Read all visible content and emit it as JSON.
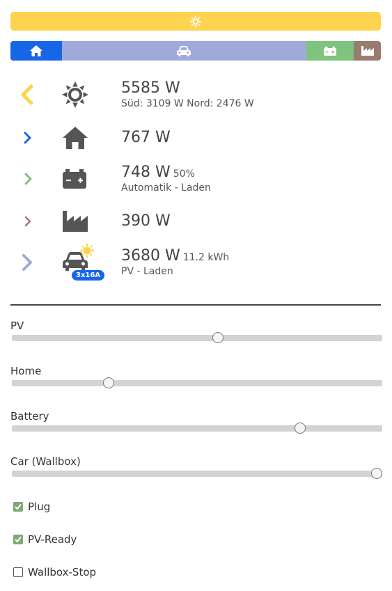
{
  "colors": {
    "pv": "#fdd34f",
    "home": "#1866e8",
    "car": "#a0a9db",
    "battery": "#7ec37e",
    "grid": "#9a7c6e",
    "icon": "#555555"
  },
  "distribution_bar": {
    "segments": [
      {
        "name": "home",
        "icon": "home-icon",
        "fraction": 0.139
      },
      {
        "name": "car",
        "icon": "car-icon",
        "fraction": 0.659
      },
      {
        "name": "battery",
        "icon": "battery-icon",
        "fraction": 0.129
      },
      {
        "name": "grid",
        "icon": "factory-icon",
        "fraction": 0.073
      }
    ]
  },
  "rows": {
    "pv": {
      "value": "5585 W",
      "sub": "Süd: 3109 W Nord: 2476 W",
      "icon": "sun-icon",
      "chevron": "chevron-left-icon"
    },
    "home": {
      "value": "767 W",
      "icon": "home-icon",
      "chevron": "chevron-right-icon"
    },
    "battery": {
      "value": "748 W",
      "extra": "50%",
      "sub": "Automatik - Laden",
      "icon": "battery-icon",
      "chevron": "chevron-right-icon"
    },
    "grid": {
      "value": "390 W",
      "icon": "factory-icon",
      "chevron": "chevron-right-icon"
    },
    "car": {
      "value": "3680 W",
      "extra": "11.2 kWh",
      "sub": "PV - Laden",
      "badge": "3x16A",
      "icon": "car-icon",
      "chevron": "chevron-right-icon"
    }
  },
  "sliders": [
    {
      "label": "PV",
      "fraction": 0.556
    },
    {
      "label": "Home",
      "fraction": 0.261
    },
    {
      "label": "Battery",
      "fraction": 0.779
    },
    {
      "label": "Car (Wallbox)",
      "fraction": 1.0
    }
  ],
  "checkboxes": [
    {
      "label": "Plug",
      "checked": true
    },
    {
      "label": "PV-Ready",
      "checked": true
    },
    {
      "label": "Wallbox-Stop",
      "checked": false
    }
  ]
}
